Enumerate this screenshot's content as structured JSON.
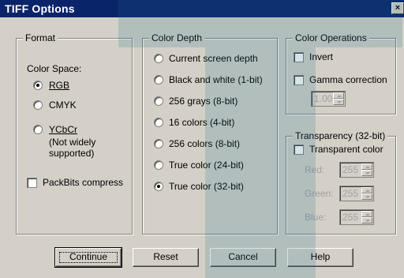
{
  "window": {
    "title": "TIFF Options",
    "close_glyph": "×"
  },
  "format": {
    "legend": "Format",
    "color_space_label": "Color Space:",
    "radios": [
      {
        "label": "RGB",
        "checked": true
      },
      {
        "label": "CMYK",
        "checked": false
      },
      {
        "label": "YCbCr",
        "checked": false
      }
    ],
    "ycbcr_note_line1": "(Not widely",
    "ycbcr_note_line2": "supported)",
    "packbits_label": "PackBits compress"
  },
  "color_depth": {
    "legend": "Color Depth",
    "options": [
      {
        "label": "Current screen depth",
        "checked": false
      },
      {
        "label": "Black and white (1-bit)",
        "checked": false
      },
      {
        "label": "256 grays (8-bit)",
        "checked": false
      },
      {
        "label": "16 colors (4-bit)",
        "checked": false
      },
      {
        "label": "256 colors (8-bit)",
        "checked": false
      },
      {
        "label": "True color (24-bit)",
        "checked": false
      },
      {
        "label": "True color (32-bit)",
        "checked": true
      }
    ]
  },
  "color_operations": {
    "legend": "Color Operations",
    "invert_label": "Invert",
    "gamma_label": "Gamma correction",
    "gamma_value": "1.00"
  },
  "transparency": {
    "legend": "Transparency (32-bit)",
    "transparent_label": "Transparent color",
    "red_label": "Red:",
    "red_value": "255",
    "green_label": "Green:",
    "green_value": "255",
    "blue_label": "Blue:",
    "blue_value": "255"
  },
  "buttons": {
    "continue": "Continue",
    "reset": "Reset",
    "cancel": "Cancel",
    "help": "Help"
  },
  "colors": {
    "titlebar": "#0a246a",
    "dialog_face": "#d4d0c8",
    "watermark": "#1f6f8b"
  }
}
